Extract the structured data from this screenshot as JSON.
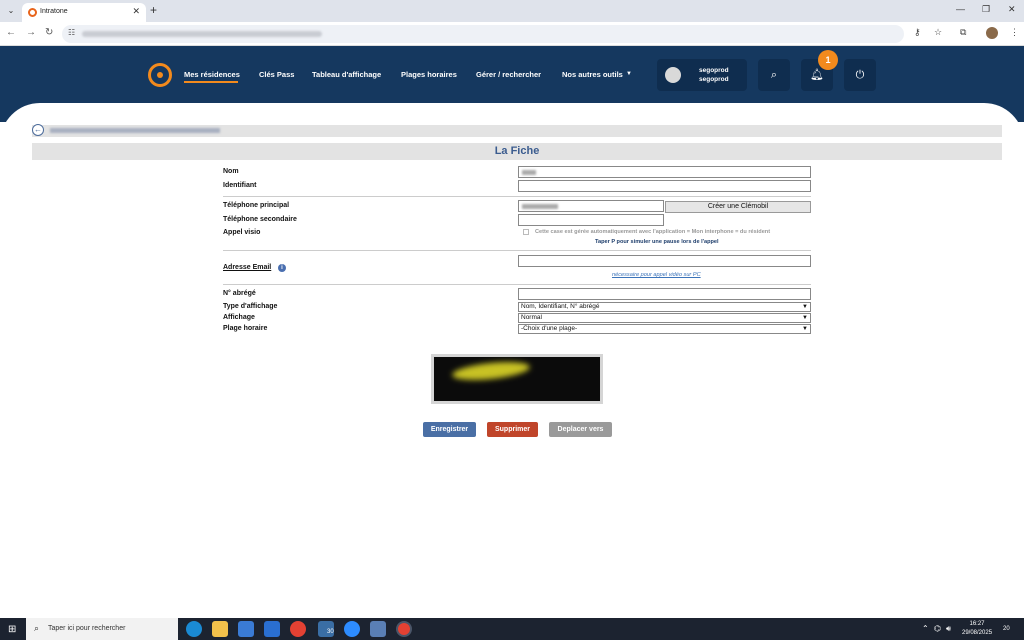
{
  "browser": {
    "tab_title": "Intratone",
    "icons": [
      "tab-list-icon",
      "close-icon",
      "plus-icon",
      "minimize-icon",
      "restore-icon",
      "close-window-icon",
      "back-icon",
      "forward-icon",
      "reload-icon",
      "site-settings-icon",
      "key-icon",
      "star-icon",
      "extensions-icon",
      "profile-avatar",
      "menu-icon"
    ]
  },
  "header": {
    "nav": [
      "Mes résidences",
      "Clés Pass",
      "Tableau d'affichage",
      "Plages horaires",
      "Gérer / rechercher",
      "Nos autres outils"
    ],
    "user": {
      "line1": "segoprod",
      "line2": "segoprod"
    },
    "notification_count": "1",
    "colors": {
      "header_bg": "#15385f",
      "accent": "#f28a1d"
    }
  },
  "page": {
    "title": "La Fiche",
    "fields": {
      "nom": "Nom",
      "identifiant": "Identifiant",
      "tel_principal": "Téléphone principal",
      "tel_secondaire": "Téléphone secondaire",
      "appel_visio": "Appel visio",
      "adresse_email": "Adresse Email",
      "num_abrege": "N° abrégé",
      "type_affichage": "Type d'affichage",
      "affichage": "Affichage",
      "plage_horaire": "Plage horaire"
    },
    "creer_clemobil": "Créer une Clémobil",
    "visio_note": "Cette case est gérée automatiquement avec l'application = Mon interphone = du résident",
    "pause_hint": "Taper P pour simuler une pause lors de l'appel",
    "email_link": "nécessaire pour appel vidéo sur PC",
    "selects": {
      "type_affichage": "Nom, Identifiant, N° abrégé",
      "affichage": "Normal",
      "plage_horaire": "-Choix d'une plage-"
    },
    "buttons": {
      "enregistrer": "Enregistrer",
      "supprimer": "Supprimer",
      "deplacer": "Deplacer vers"
    },
    "button_colors": {
      "enregistrer": "#4a6fa5",
      "supprimer": "#c0452a",
      "deplacer": "#9a9a9a"
    }
  },
  "taskbar": {
    "search_placeholder": "Taper ici pour rechercher",
    "time": "16:27",
    "date": "29/08/2025",
    "calendar_badge": "30",
    "notification_count": "20"
  }
}
